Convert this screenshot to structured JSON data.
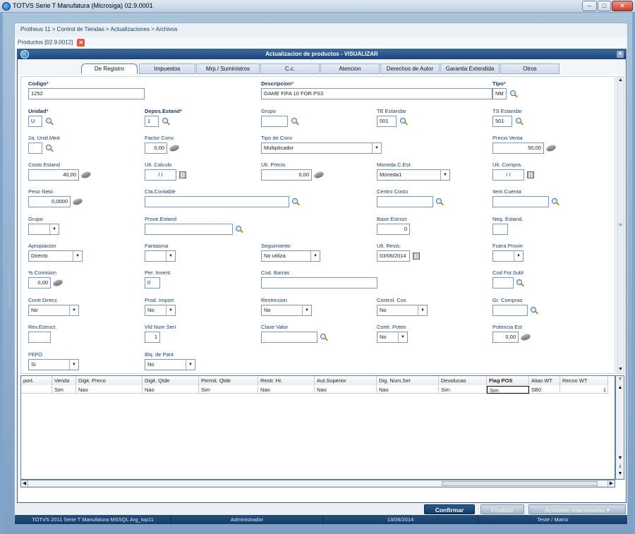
{
  "window": {
    "title": "TOTVS Serie T Manufatura (Microsiga) 02.9.0001",
    "minimize": "‒",
    "maximize": "□",
    "close": "✕"
  },
  "breadcrumb": "Protheus 11 > Control de Tiendas > Actualizaciones > Archivos",
  "doc_tab": {
    "label": "Productos [02.9.0012]",
    "close": "✕"
  },
  "dialog": {
    "title": "Actualizacion de productos - VISUALIZAR",
    "tabs": [
      "De Registro",
      "Impuestos",
      "Mrp / Suministros",
      "C.c.",
      "Atencion",
      "Derechos de Autor",
      "Garantia Extendida",
      "Otros"
    ]
  },
  "fields": {
    "codigo": {
      "label": "Codigo",
      "value": "1252"
    },
    "descripcion": {
      "label": "Descripcion",
      "value": "GAME FIFA 10 FOR PS3"
    },
    "tipo": {
      "label": "Tipo",
      "value": "NM"
    },
    "unidad": {
      "label": "Unidad",
      "value": "U"
    },
    "depos_estand": {
      "label": "Depos.Estand",
      "value": "1"
    },
    "grupo1": {
      "label": "Grupo",
      "value": ""
    },
    "te_estandar": {
      "label": "TE Estandar",
      "value": "001"
    },
    "ts_estandar": {
      "label": "TS Estandar",
      "value": "501"
    },
    "unid_med2": {
      "label": "2a. Unid.Med",
      "value": ""
    },
    "factor_conv": {
      "label": "Factor Conv.",
      "value": "0,00"
    },
    "tipo_conv": {
      "label": "Tipo de Conv",
      "value": "Multiplicador"
    },
    "precio_venta": {
      "label": "Precio Venta",
      "value": "50,00"
    },
    "costo_estand": {
      "label": "Costo Estand",
      "value": "40,00"
    },
    "ult_calculo": {
      "label": "Ult. Calculo",
      "value": "/ /"
    },
    "ult_precio": {
      "label": "Ult. Precio",
      "value": "0,00"
    },
    "moneda_cest": {
      "label": "Moneda C.Est",
      "value": "Moneda1"
    },
    "ult_compra": {
      "label": "Ult. Compra",
      "value": "/ /"
    },
    "peso_neto": {
      "label": "Peso Neto",
      "value": "0,0000"
    },
    "cta_contable": {
      "label": "Cta.Contable",
      "value": ""
    },
    "centro_costo": {
      "label": "Centro Costo",
      "value": ""
    },
    "item_cuenta": {
      "label": "Item Cuenta",
      "value": ""
    },
    "grupo2": {
      "label": "Grupo",
      "value": ""
    },
    "prove_estand": {
      "label": "Prove.Estand",
      "value": ""
    },
    "base_estruct": {
      "label": "Base Estruct",
      "value": "0"
    },
    "neg_estand": {
      "label": "Neg. Estand.",
      "value": ""
    },
    "apropiacion": {
      "label": "Apropiacion",
      "value": "Directo"
    },
    "fantasma": {
      "label": "Fantasma",
      "value": ""
    },
    "seguimiento": {
      "label": "Seguimiento",
      "value": "No utiliza"
    },
    "ult_revis": {
      "label": "Ult. Revis.",
      "value": "03/06/2014"
    },
    "fuera_provin": {
      "label": "Fuera Provin",
      "value": ""
    },
    "comision": {
      "label": "% Comision",
      "value": "0,00"
    },
    "per_invent": {
      "label": "Per. Invent.",
      "value": "0"
    },
    "cod_barras": {
      "label": "Cod. Barras",
      "value": ""
    },
    "cod_for_subl": {
      "label": "Cod For.Subl",
      "value": ""
    },
    "contr_direcc": {
      "label": "Contr.Direcc",
      "value": "No"
    },
    "prod_import": {
      "label": "Prod. Import",
      "value": "No"
    },
    "restriccion": {
      "label": "Restriccion",
      "value": "No"
    },
    "control_cos": {
      "label": "Control. Cos",
      "value": "No"
    },
    "gr_compras": {
      "label": "Gr. Compras",
      "value": ""
    },
    "rev_estruct": {
      "label": "Rev.Estruct.",
      "value": ""
    },
    "vld_num_seri": {
      "label": "Vld Num Seri",
      "value": "1"
    },
    "clase_valor": {
      "label": "Clase Valor",
      "value": ""
    },
    "contr_poten": {
      "label": "Contr. Poten",
      "value": "No"
    },
    "potencia_est": {
      "label": "Potencia Est",
      "value": "0,00"
    },
    "fefo": {
      "label": "FEFO",
      "value": "Si"
    },
    "blq_pant": {
      "label": "Blq. de Pant",
      "value": "No"
    }
  },
  "grid": {
    "headers": [
      "port.",
      "Venda",
      "Digit. Preco",
      "Digit. Qtde",
      "Permit. Qtde",
      "Restr. Hr.",
      "Aut.Superior",
      "Dig. Num.Ser",
      "Devolucao",
      "Flag POS",
      "Alias WT",
      "Recno WT"
    ],
    "row": [
      "",
      "Sim",
      "Nao",
      "Nao",
      "Sim",
      "Nao",
      "Nao",
      "Nao",
      "Sim",
      "Sim",
      "SB0",
      "1"
    ]
  },
  "buttons": {
    "confirm": "Confirmar",
    "finish": "Finalizar",
    "actions": "Acciones relacionadas"
  },
  "status": [
    "TOTVS 2011 Serie T Manufatura MSSQL Arg_top11",
    "Administrador",
    "13/06/2014",
    "Teste / Matriz"
  ]
}
